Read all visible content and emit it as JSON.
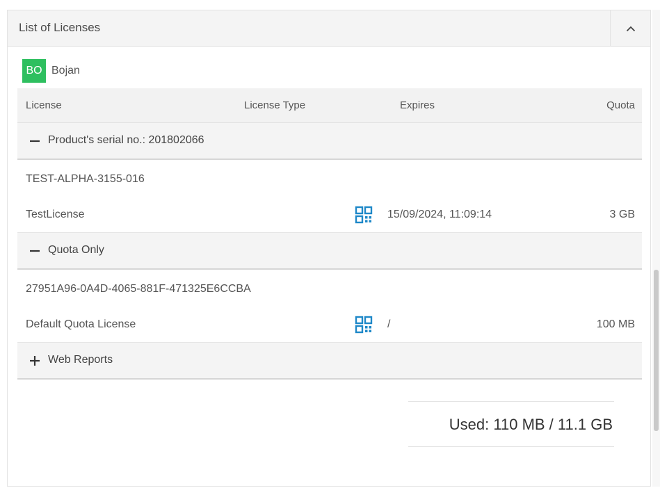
{
  "panel": {
    "title": "List of Licenses"
  },
  "user": {
    "initials": "BO",
    "name": "Bojan",
    "avatar_color": "#2ebf5f"
  },
  "columns": {
    "license": "License",
    "license_type": "License Type",
    "expires": "Expires",
    "quota": "Quota"
  },
  "groups": [
    {
      "label": "Product's serial no.: 201802066",
      "expanded": true,
      "toggle_icon": "minus-icon",
      "license": {
        "key": "TEST-ALPHA-3155-016",
        "name": "TestLicense",
        "type_icon": "qr-code-icon",
        "expires": "15/09/2024, 11:09:14",
        "quota": "3 GB"
      }
    },
    {
      "label": "Quota Only",
      "expanded": true,
      "toggle_icon": "minus-icon",
      "license": {
        "key": "27951A96-0A4D-4065-881F-471325E6CCBA",
        "name": "Default Quota License",
        "type_icon": "qr-code-icon",
        "expires": "/",
        "quota": "100 MB"
      }
    },
    {
      "label": "Web Reports",
      "expanded": false,
      "toggle_icon": "plus-icon"
    }
  ],
  "summary": {
    "used_text": "Used: 110 MB / 11.1 GB"
  },
  "colors": {
    "accent_icon": "#1e88c8",
    "header_bg": "#f4f4f4"
  }
}
